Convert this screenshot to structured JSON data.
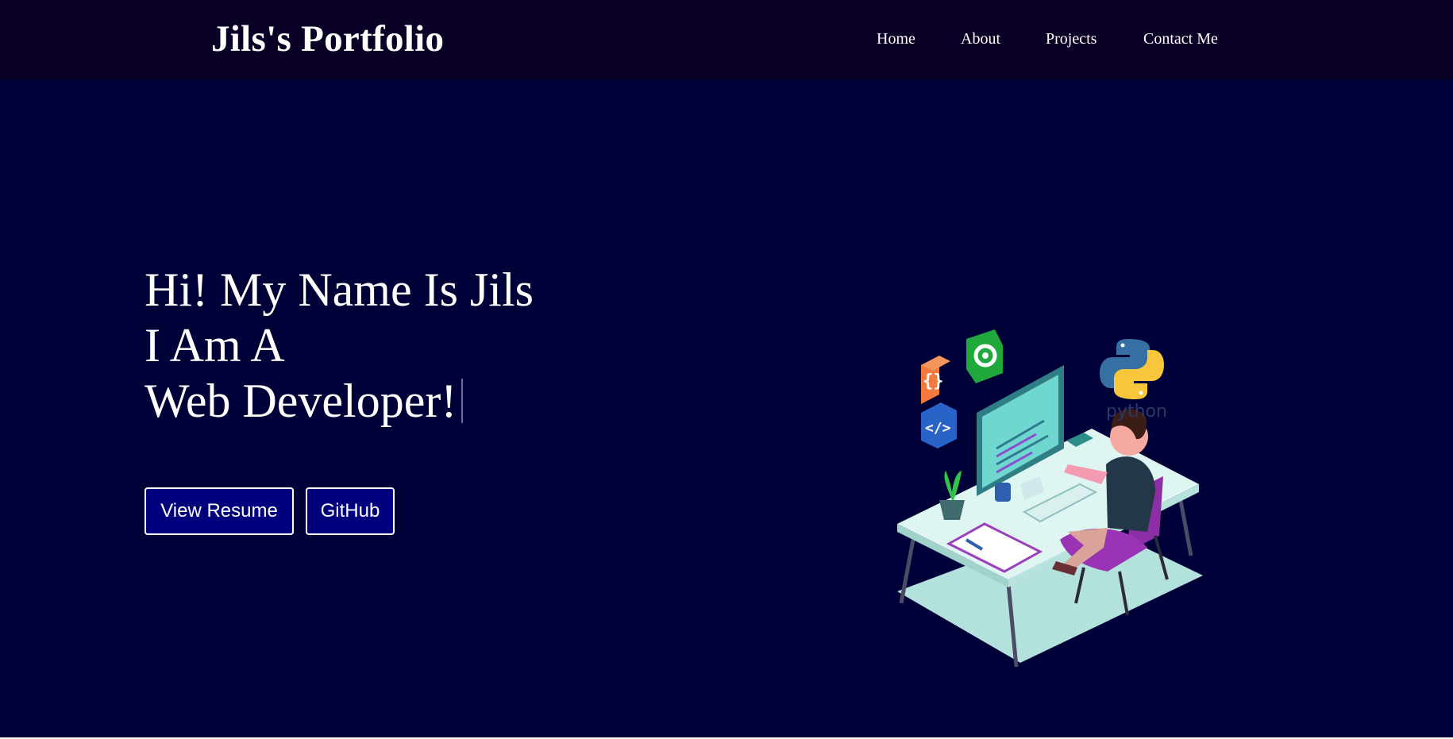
{
  "header": {
    "brand": "Jils's Portfolio",
    "nav": [
      "Home",
      "About",
      "Projects",
      "Contact Me"
    ]
  },
  "hero": {
    "line1": "Hi! My Name Is Jils",
    "line2": "I Am A",
    "line3": "Web Developer!",
    "buttons": {
      "resume": "View Resume",
      "github": "GitHub"
    },
    "illustration_label": "python"
  },
  "colors": {
    "page_background": "#000038",
    "navbar_background": "#0a0025",
    "button_background": "#00007f",
    "text": "#ffffff"
  },
  "icons": [
    "curly-braces-icon",
    "gear-icon",
    "code-tag-icon",
    "python-logo-icon"
  ]
}
